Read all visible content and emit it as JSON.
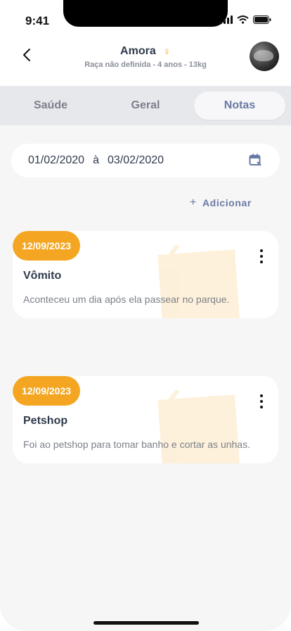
{
  "status": {
    "time": "9:41"
  },
  "header": {
    "pet_name": "Amora",
    "gender_symbol": "♀",
    "details": "Raça não definida - 4 anos - 13kg"
  },
  "tabs": [
    {
      "label": "Saúde",
      "active": false
    },
    {
      "label": "Geral",
      "active": false
    },
    {
      "label": "Notas",
      "active": true
    }
  ],
  "date_filter": {
    "start": "01/02/2020",
    "separator": "à",
    "end": "03/02/2020"
  },
  "actions": {
    "add_label": "Adicionar",
    "add_symbol": "+"
  },
  "notes": [
    {
      "date": "12/09/2023",
      "title": "Vômito",
      "text": "Aconteceu um dia após ela passear no parque."
    },
    {
      "date": "12/09/2023",
      "title": "Petshop",
      "text": "Foi ao petshop para tomar banho e cortar as unhas."
    }
  ],
  "colors": {
    "accent": "#f4a622",
    "primary_text": "#2f3a4c",
    "link": "#6a7aa6"
  }
}
